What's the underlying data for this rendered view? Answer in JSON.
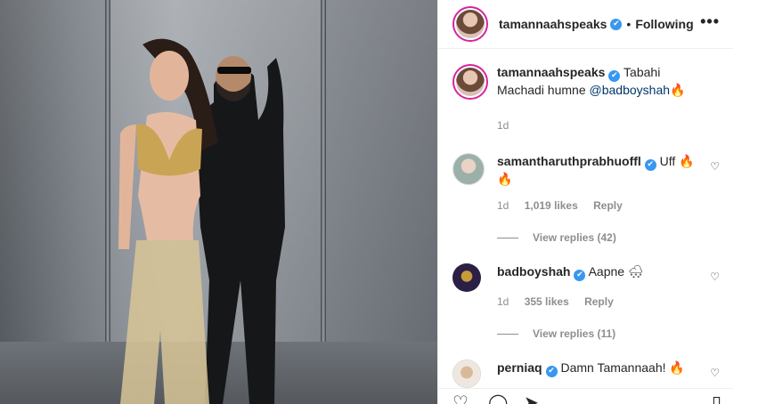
{
  "post": {
    "author": "tamannaahspeaks",
    "follow_status": "Following",
    "more_label": "•••"
  },
  "caption": {
    "username": "tamannaahspeaks",
    "text": "Tabahi Machadi humne",
    "mention": "@badboyshah",
    "emoji": "🔥",
    "time": "1d"
  },
  "comments": [
    {
      "username": "samantharuthprabhuoffl",
      "text": "Uff 🔥",
      "text2": "🔥",
      "time": "1d",
      "likes": "1,019 likes",
      "reply": "Reply",
      "view_replies": "View replies (42)"
    },
    {
      "username": "badboyshah",
      "text": "Aapne 🌨",
      "time": "1d",
      "likes": "355 likes",
      "reply": "Reply",
      "view_replies": "View replies (11)"
    },
    {
      "username": "perniaq",
      "text": "Damn Tamannaah! 🔥"
    }
  ],
  "icons": {
    "verified": "verified-badge",
    "heart": "heart-icon",
    "comment": "comment-icon",
    "share": "share-icon",
    "save": "save-icon",
    "more": "more-icon"
  },
  "colors": {
    "accent_link": "#00376b",
    "verified": "#3897f0",
    "story_ring": "#d6249f",
    "muted": "#8e8e8e"
  }
}
